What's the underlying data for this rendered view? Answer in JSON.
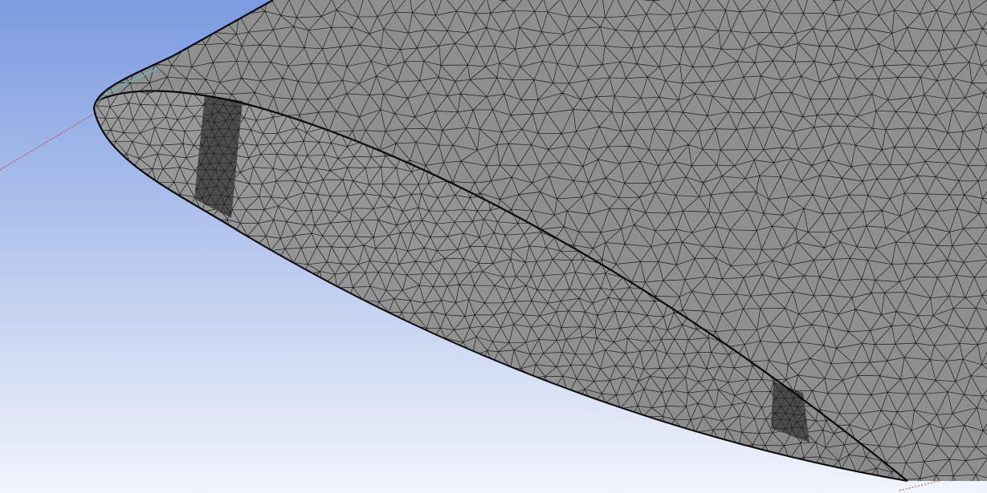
{
  "viewport": {
    "background_top": "#7b9ae0",
    "background_bottom": "#f1f4fb"
  },
  "model": {
    "surface_color": "#8f8f8f",
    "surface_light": "#a3a3a3",
    "section_face_color": "#959595",
    "spar_color": "#4d4d4d",
    "mesh_line_color": "#1c1c1c",
    "edge_color": "#0a0a0a",
    "axis_line_color": "#d04040",
    "highlight_edge_color": "#5ec9c2"
  }
}
